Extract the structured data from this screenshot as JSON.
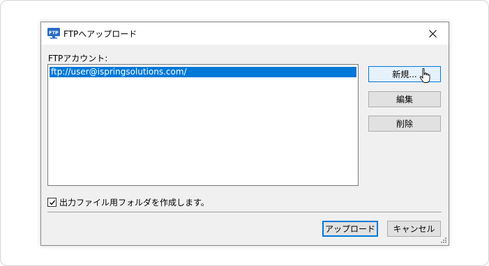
{
  "window": {
    "title": "FTPへアップロード",
    "icon": "ftp-icon",
    "close_icon": "close-icon"
  },
  "account_list": {
    "label": "FTPアカウント:",
    "items": [
      "ftp://user@ispringsolutions.com/"
    ],
    "selected_index": 0
  },
  "side_buttons": {
    "new": "新規...",
    "edit": "編集",
    "delete": "削除"
  },
  "checkbox": {
    "label": "出力ファイル用フォルダを作成します。",
    "checked": true
  },
  "footer": {
    "upload": "アップロード",
    "cancel": "キャンセル"
  },
  "colors": {
    "selection": "#0078d7",
    "dialog_bg": "#f0f0f0",
    "button_bg": "#e1e1e1"
  }
}
